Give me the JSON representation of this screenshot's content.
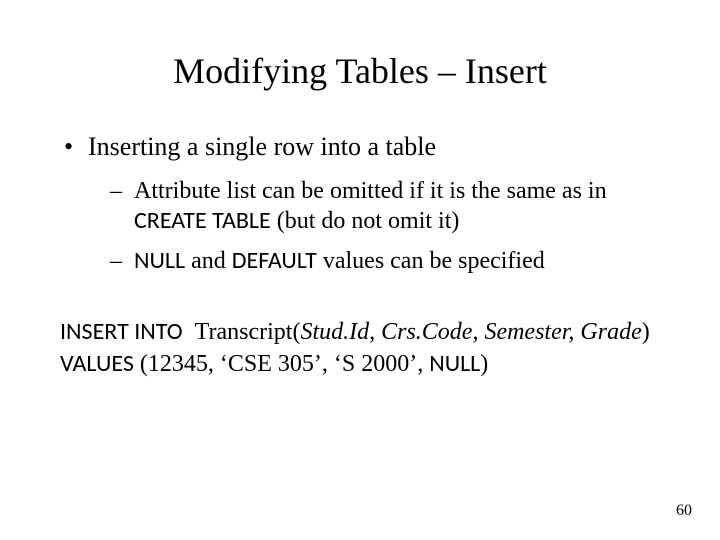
{
  "title": "Modifying Tables – Insert",
  "bullets": {
    "l1": "Inserting a single row into a table",
    "l2a_pre": "Attribute list can be omitted if it is the same as in ",
    "l2a_kw": "CREATE TABLE",
    "l2a_post": " (but do not omit it)",
    "l2b_kw": "NULL",
    "l2b_mid": " and ",
    "l2b_kw2": "DEFAULT",
    "l2b_post": " values can be specified"
  },
  "sql": {
    "insert_kw": "INSERT INTO",
    "table": "Transcript",
    "cols_open": "(",
    "cols": "Stud.Id, Crs.Code, Semester, Grade",
    "cols_close": ")",
    "values_kw": "VALUES",
    "vals": " (12345, ‘CSE 305’, ‘S 2000’, ",
    "null_kw": "NULL",
    "vals_close": ")"
  },
  "page": "60"
}
